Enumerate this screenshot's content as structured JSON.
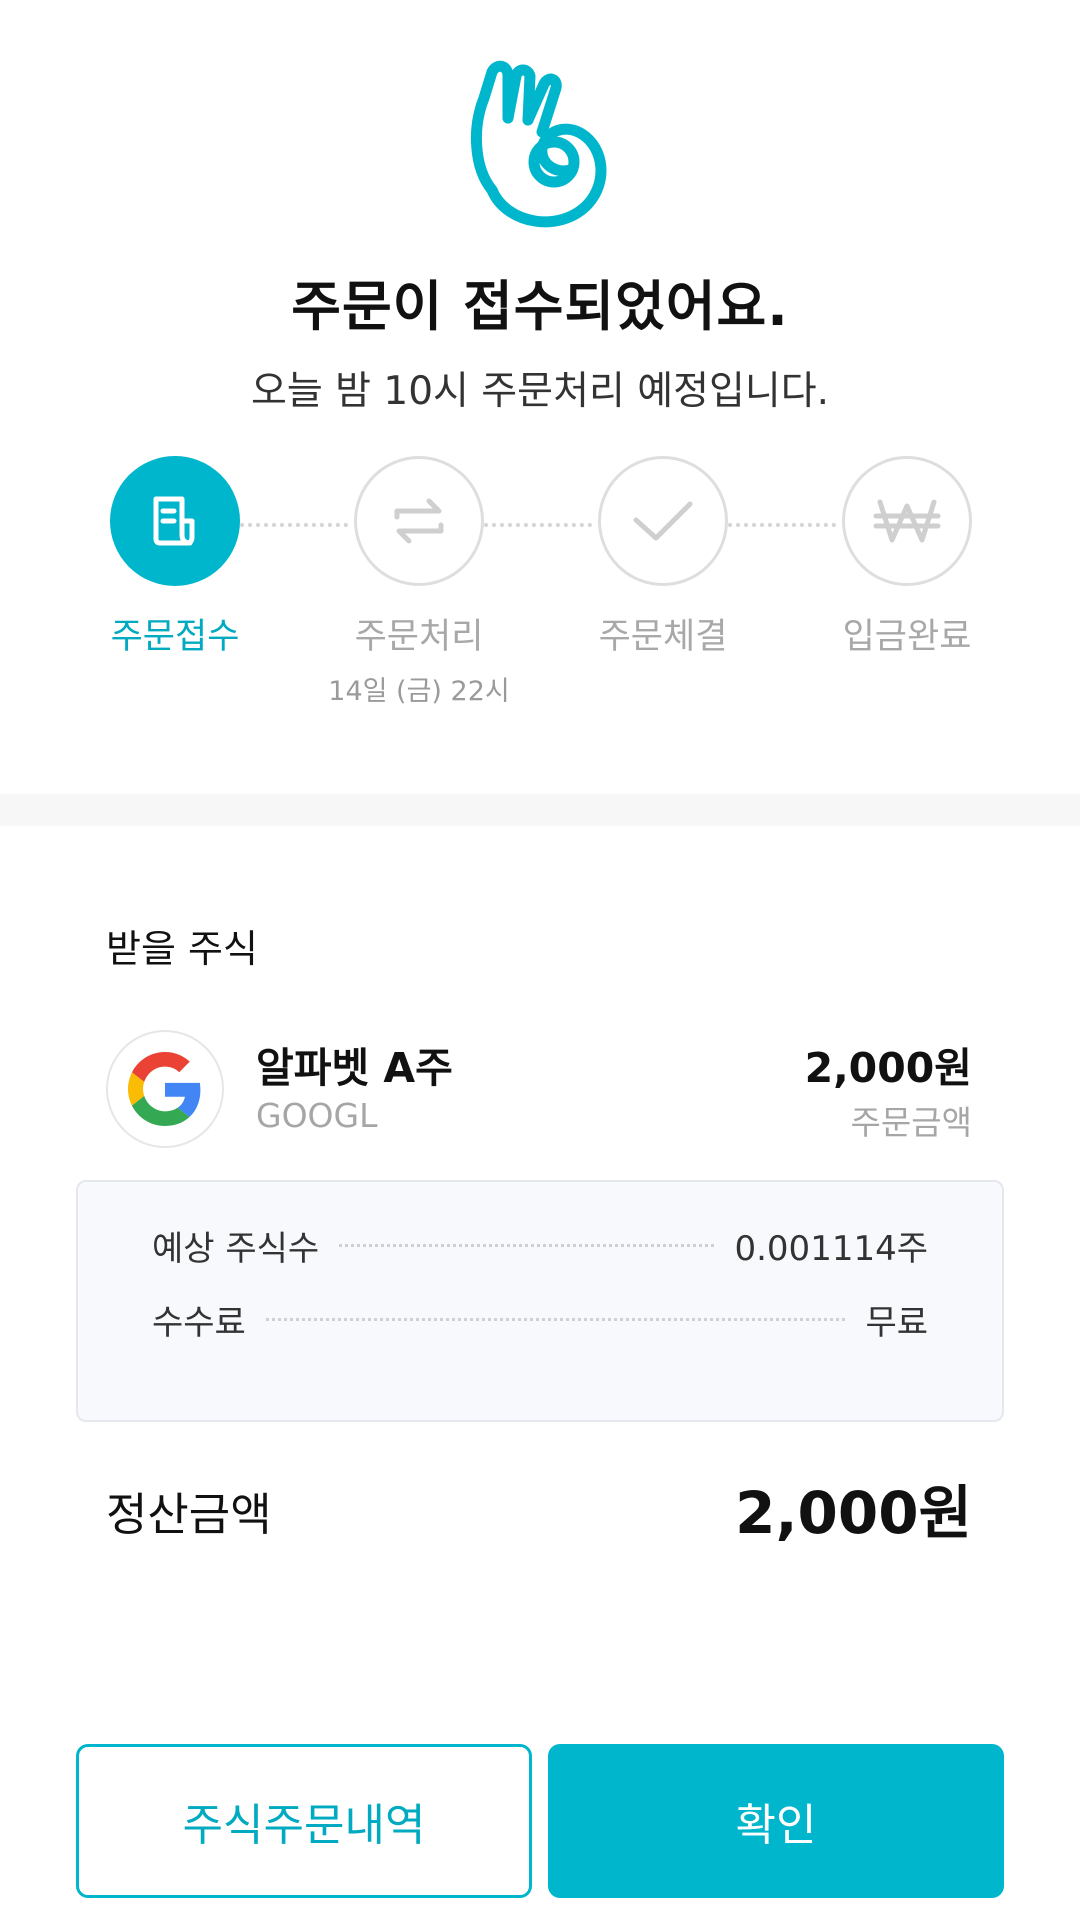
{
  "header": {
    "title": "주문이 접수되었어요.",
    "subtitle": "오늘 밤 10시 주문처리 예정입니다."
  },
  "steps": [
    {
      "label": "주문접수",
      "sub": "",
      "icon": "document-icon",
      "active": true
    },
    {
      "label": "주문처리",
      "sub": "14일 (금) 22시",
      "icon": "exchange-arrows-icon",
      "active": false
    },
    {
      "label": "주문체결",
      "sub": "",
      "icon": "check-icon",
      "active": false
    },
    {
      "label": "입금완료",
      "sub": "",
      "icon": "won-icon",
      "active": false
    }
  ],
  "stock_section": {
    "title": "받을 주식",
    "name": "알파벳 A주",
    "ticker": "GOOGL",
    "amount": "2,000원",
    "amount_label": "주문금액"
  },
  "details": {
    "shares_label": "예상 주식수",
    "shares_value": "0.001114주",
    "fee_label": "수수료",
    "fee_value": "무료"
  },
  "total": {
    "label": "정산금액",
    "value": "2,000원"
  },
  "buttons": {
    "history": "주식주문내역",
    "confirm": "확인"
  },
  "colors": {
    "accent": "#00b6cc",
    "muted": "#a8a8a8"
  }
}
